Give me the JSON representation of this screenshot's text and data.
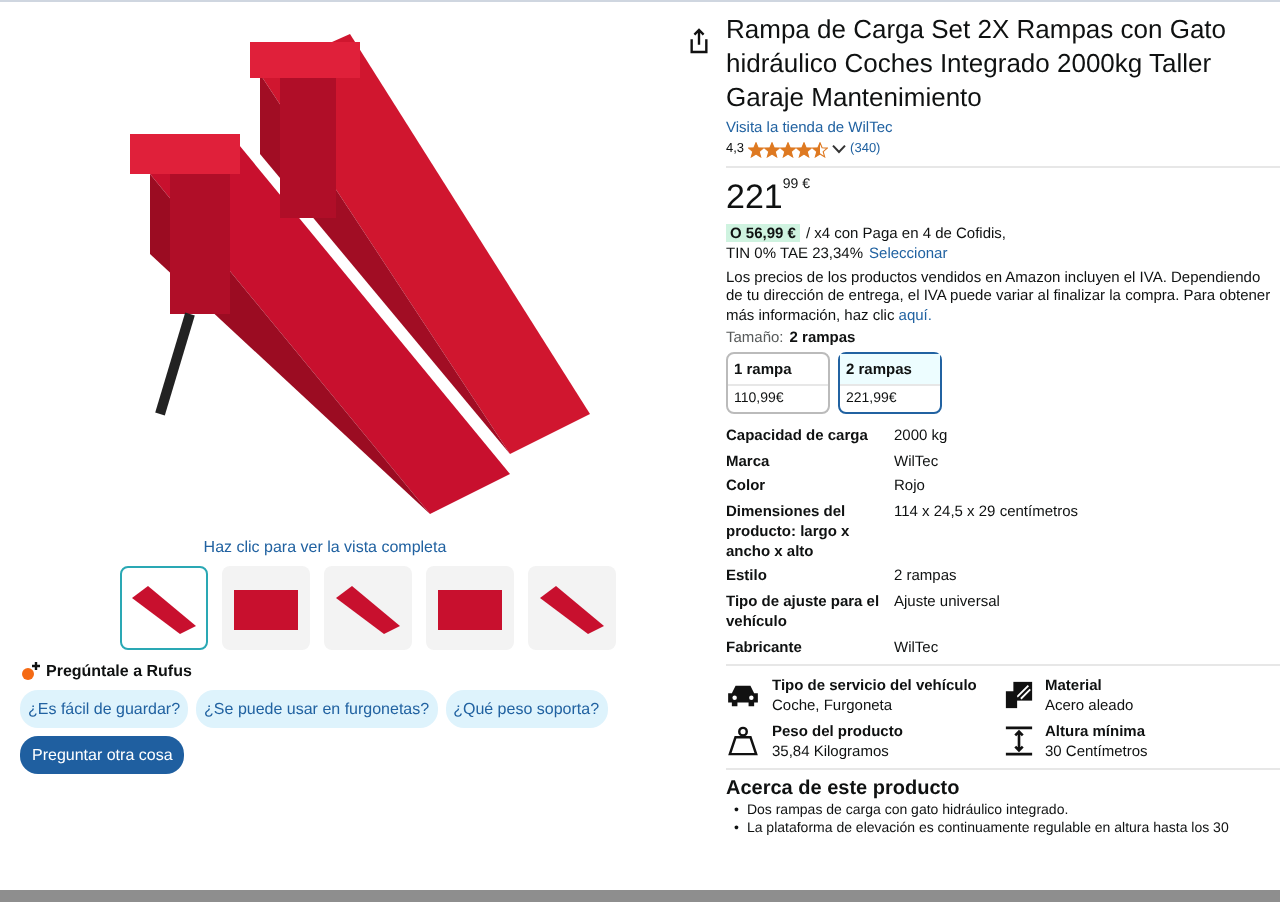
{
  "gallery": {
    "link": "Haz clic para ver la vista completa",
    "thumbnails": [
      {
        "selected": true
      },
      {
        "selected": false
      },
      {
        "selected": false
      },
      {
        "selected": false
      },
      {
        "selected": false
      }
    ]
  },
  "rufus": {
    "title": "Pregúntale a Rufus",
    "questions": [
      "¿Es fácil de guardar?",
      "¿Se puede usar en furgonetas?",
      "¿Qué peso soporta?"
    ],
    "button": "Preguntar otra cosa"
  },
  "product": {
    "title": "Rampa de Carga Set 2X Rampas con Gato hidráulico Coches Integrado 2000kg Taller Garaje Mantenimiento",
    "store_link": "Visita la tienda de WilTec",
    "rating": "4,3",
    "stars": 4.5,
    "review_count": "(340)",
    "price_whole": "221",
    "price_fraction": "99 €",
    "installment_amount": "O 56,99 €",
    "installment_text": "/ x4 con Paga en 4 de Cofidis,",
    "installment_rate": "TIN 0% TAE 23,34%",
    "installment_link": "Seleccionar",
    "vat_note": "Los precios de los productos vendidos en Amazon incluyen el IVA. Dependiendo de tu dirección de entrega, el IVA puede variar al finalizar la compra. Para obtener más información, haz clic",
    "vat_link": "aquí.",
    "size_label": "Tamaño:",
    "size_value": "2 rampas",
    "sizes": [
      {
        "name": "1 rampa",
        "price": "110,99€",
        "selected": false
      },
      {
        "name": "2 rampas",
        "price": "221,99€",
        "selected": true
      }
    ],
    "specs": [
      {
        "label": "Capacidad de carga",
        "value": "2000 kg"
      },
      {
        "label": "Marca",
        "value": "WilTec"
      },
      {
        "label": "Color",
        "value": "Rojo"
      },
      {
        "label": "Dimensiones del producto: largo x ancho x alto",
        "value": "114 x 24,5 x 29 centímetros"
      },
      {
        "label": "Estilo",
        "value": "2 rampas"
      },
      {
        "label": "Tipo de ajuste para el vehículo",
        "value": "Ajuste universal"
      },
      {
        "label": "Fabricante",
        "value": "WilTec"
      }
    ],
    "highlights": [
      {
        "kind": "car",
        "label": "Tipo de servicio del vehículo",
        "value": "Coche, Furgoneta"
      },
      {
        "kind": "material",
        "label": "Material",
        "value": "Acero aleado"
      },
      {
        "kind": "weight",
        "label": "Peso del producto",
        "value": "35,84 Kilogramos"
      },
      {
        "kind": "height",
        "label": "Altura mínima",
        "value": "30 Centímetros"
      }
    ],
    "about_title": "Acerca de este producto",
    "about": [
      {
        "marker": "•",
        "text": "Dos rampas de carga con gato hidráulico integrado."
      },
      {
        "marker": "•",
        "text": "La plataforma de elevación es continuamente regulable en altura hasta los 30"
      }
    ]
  }
}
